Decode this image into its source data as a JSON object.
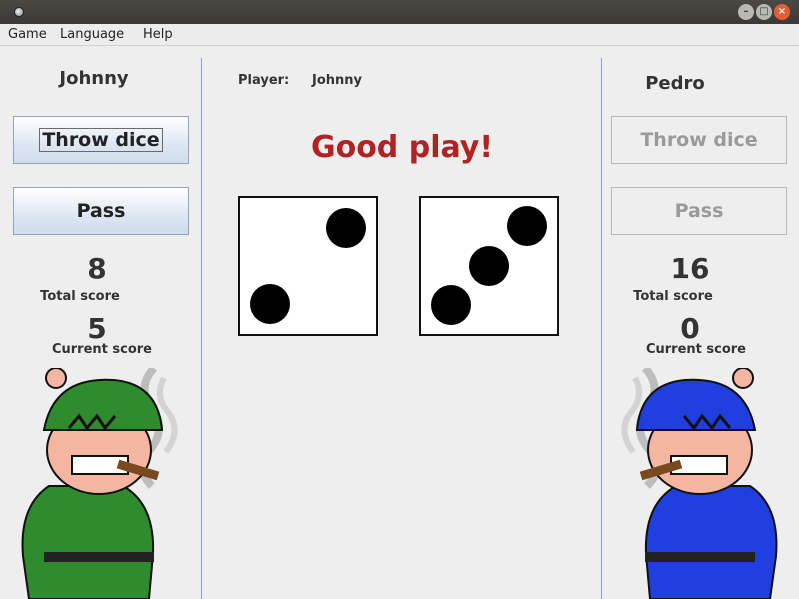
{
  "window": {
    "min_glyph": "–",
    "max_glyph": "□",
    "close_glyph": "×"
  },
  "menu": {
    "items": [
      "Game",
      "Language",
      "Help"
    ]
  },
  "left_player": {
    "name": "Johnny",
    "throw_label": "Throw dice",
    "pass_label": "Pass",
    "total_score": "8",
    "total_label": "Total score",
    "current_score": "5",
    "current_label": "Current score",
    "avatar_color": "#2e8b2e"
  },
  "right_player": {
    "name": "Pedro",
    "throw_label": "Throw dice",
    "pass_label": "Pass",
    "total_score": "16",
    "total_label": "Total score",
    "current_score": "0",
    "current_label": "Current score",
    "avatar_color": "#1f3fe0"
  },
  "center": {
    "player_label": "Player:",
    "player_value": "Johnny",
    "message": "Good play!"
  },
  "dice": [
    {
      "value": 2
    },
    {
      "value": 3
    }
  ]
}
